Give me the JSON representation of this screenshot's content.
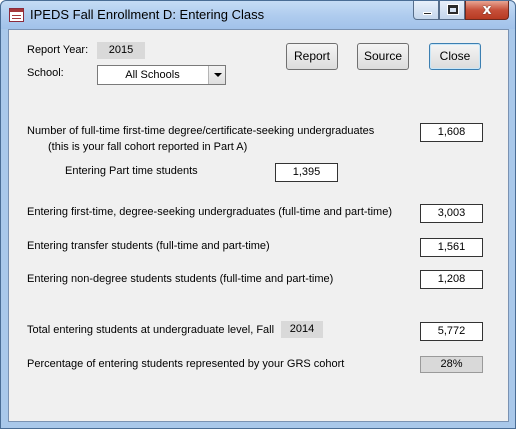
{
  "window": {
    "title": "IPEDS Fall Enrollment D: Entering Class",
    "minimize_label": "minimize",
    "maximize_label": "maximize",
    "close_glyph": "x"
  },
  "header": {
    "report_year_label": "Report Year:",
    "report_year_value": "2015",
    "school_label": "School:",
    "school_value": "All Schools",
    "report_button": "Report",
    "source_button": "Source",
    "close_button": "Close"
  },
  "fields": {
    "fulltime_line1": "Number of full-time first-time degree/certificate-seeking undergraduates",
    "fulltime_line2": "(this is your fall cohort reported in Part A)",
    "fulltime_value": "1,608",
    "parttime_label": "Entering Part time students",
    "parttime_value": "1,395",
    "firsttime_label": "Entering first-time, degree-seeking undergraduates (full-time and part-time)",
    "firsttime_value": "3,003",
    "transfer_label": "Entering transfer students (full-time and part-time)",
    "transfer_value": "1,561",
    "nondegree_label": "Entering non-degree students students (full-time and part-time)",
    "nondegree_value": "1,208",
    "total_label": "Total entering students at undergraduate level, Fall",
    "total_year": "2014",
    "total_value": "5,772",
    "percent_label": "Percentage of entering students represented by your GRS cohort",
    "percent_value": "28%"
  }
}
